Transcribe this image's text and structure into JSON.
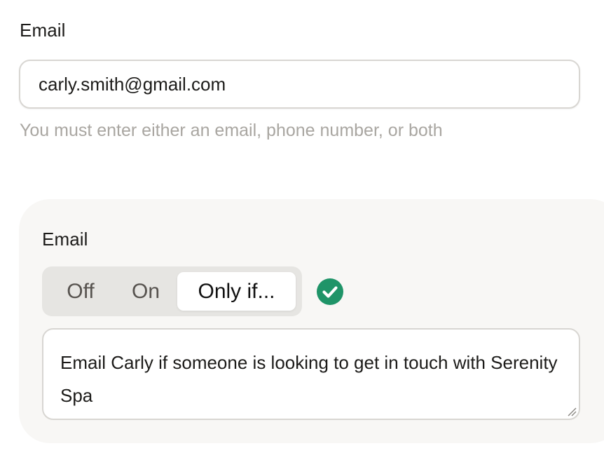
{
  "email_section": {
    "label": "Email",
    "input_value": "carly.smith@gmail.com",
    "helper_text": "You must enter either an email, phone number, or both"
  },
  "notification_card": {
    "label": "Email",
    "segmented_options": [
      "Off",
      "On",
      "Only if..."
    ],
    "selected_option": "Only if...",
    "status_icon": "check-circle-icon",
    "condition_text": "Email Carly if someone is looking to get in touch with Serenity Spa"
  },
  "colors": {
    "accent_green": "#1f9468",
    "card_background": "#f8f7f5",
    "segmented_background": "#e6e5e2",
    "helper_text": "#a9a6a1"
  }
}
